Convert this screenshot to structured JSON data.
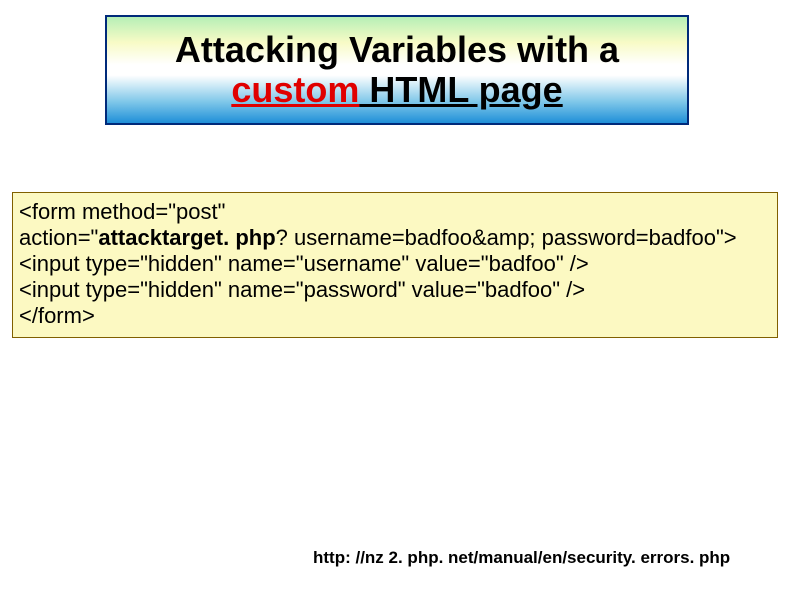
{
  "title": {
    "line1": "Attacking Variables with a",
    "line2_custom": "custom",
    "line2_rest": " HTML page"
  },
  "code": {
    "l1": "<form method=\"post\"",
    "l2_pre": "action=\"",
    "l2_bold": "attacktarget. php",
    "l2_post": "? username=badfoo&amp; password=badfoo\">",
    "l3": "<input type=\"hidden\" name=\"username\" value=\"badfoo\" />",
    "l4": "<input type=\"hidden\" name=\"password\" value=\"badfoo\" />",
    "l5": "</form>"
  },
  "footer": {
    "url": "http: //nz 2. php. net/manual/en/security. errors. php"
  }
}
